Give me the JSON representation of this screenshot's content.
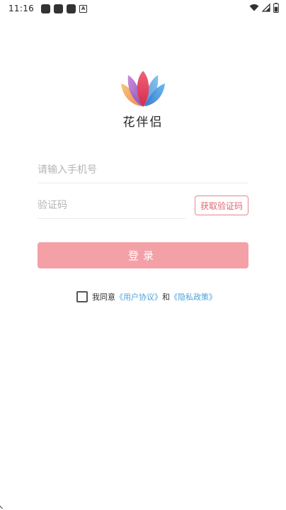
{
  "status_bar": {
    "time": "11:16",
    "notification_icons": [
      "notification-icon",
      "notification-icon",
      "notification-icon",
      "a-icon"
    ],
    "right_icons": [
      "wifi-icon",
      "signal-icon",
      "battery-icon"
    ]
  },
  "brand": {
    "name": "花伴侣",
    "colors": {
      "pink": "#e8445a",
      "purple": "#9b59b6",
      "blue": "#3f8fd8",
      "orange": "#f0a040"
    }
  },
  "form": {
    "phone_placeholder": "请输入手机号",
    "phone_value": "",
    "code_placeholder": "验证码",
    "code_value": "",
    "get_code_label": "获取验证码",
    "login_label": "登录"
  },
  "agreement": {
    "prefix": "我同意",
    "user_agreement": "《用户协议》",
    "conjunction": "和",
    "privacy_policy": "《隐私政策》",
    "checked": false
  },
  "colors": {
    "accent": "#f4a0a7",
    "accent_border": "#e8858f",
    "link": "#4aa3df"
  }
}
